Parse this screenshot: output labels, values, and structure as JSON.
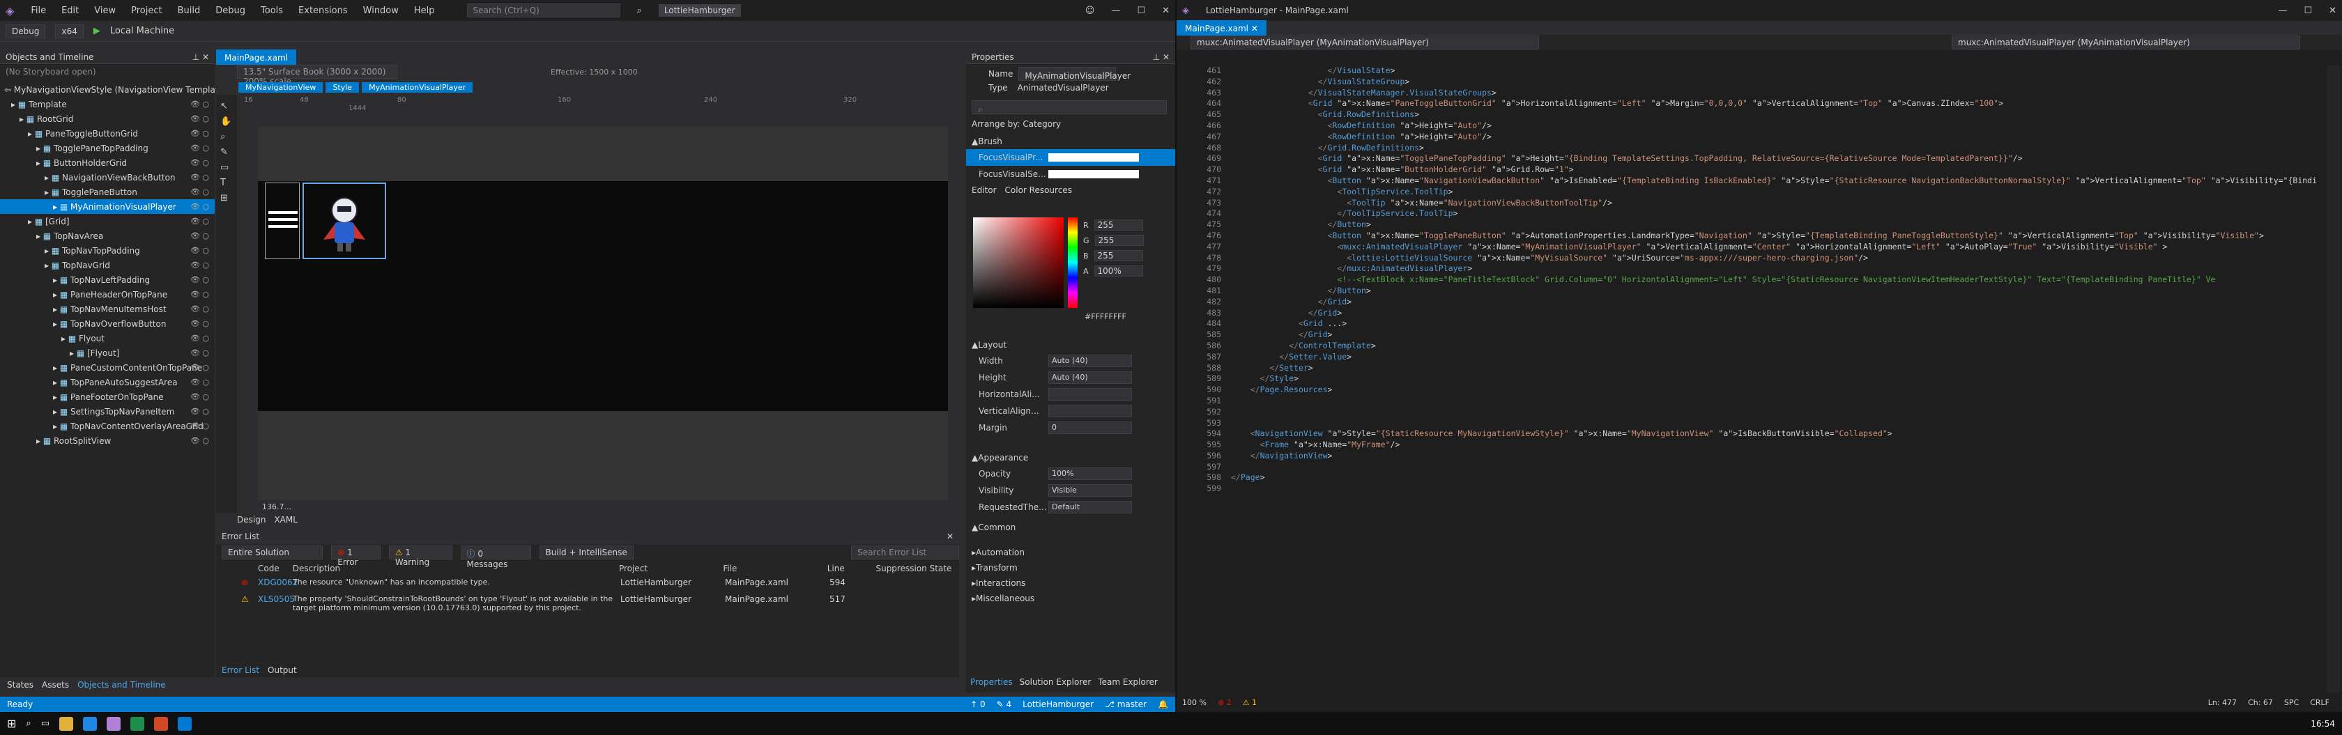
{
  "vs": {
    "menu": [
      "File",
      "Edit",
      "View",
      "Project",
      "Build",
      "Debug",
      "Tools",
      "Extensions",
      "Window",
      "Help"
    ],
    "search_placeholder": "Search (Ctrl+Q)",
    "solution": "LottieHamburger",
    "config": "Debug",
    "platform": "x64",
    "run": "Local Machine",
    "objects_title": "Objects and Timeline",
    "storyboard": "(No Storyboard open)",
    "root_node": "MyNavigationViewStyle (NavigationView Template)",
    "tree": [
      {
        "label": "Template",
        "indent": 1
      },
      {
        "label": "RootGrid",
        "indent": 2
      },
      {
        "label": "PaneToggleButtonGrid",
        "indent": 3
      },
      {
        "label": "TogglePaneTopPadding",
        "indent": 4
      },
      {
        "label": "ButtonHolderGrid",
        "indent": 4
      },
      {
        "label": "NavigationViewBackButton",
        "indent": 5
      },
      {
        "label": "TogglePaneButton",
        "indent": 5
      },
      {
        "label": "MyAnimationVisualPlayer",
        "indent": 6,
        "selected": true
      },
      {
        "label": "[Grid]",
        "indent": 3
      },
      {
        "label": "TopNavArea",
        "indent": 4
      },
      {
        "label": "TopNavTopPadding",
        "indent": 5
      },
      {
        "label": "TopNavGrid",
        "indent": 5
      },
      {
        "label": "TopNavLeftPadding",
        "indent": 6
      },
      {
        "label": "PaneHeaderOnTopPane",
        "indent": 6
      },
      {
        "label": "TopNavMenuItemsHost",
        "indent": 6
      },
      {
        "label": "TopNavOverflowButton",
        "indent": 6
      },
      {
        "label": "Flyout",
        "indent": 7
      },
      {
        "label": "[Flyout]",
        "indent": 8
      },
      {
        "label": "PaneCustomContentOnTopPane",
        "indent": 6
      },
      {
        "label": "TopPaneAutoSuggestArea",
        "indent": 6
      },
      {
        "label": "PaneFooterOnTopPane",
        "indent": 6
      },
      {
        "label": "SettingsTopNavPaneItem",
        "indent": 6
      },
      {
        "label": "TopNavContentOverlayAreaGrid",
        "indent": 6
      },
      {
        "label": "RootSplitView",
        "indent": 4
      }
    ],
    "bottom_tabs": [
      "States",
      "Assets",
      "Objects and Timeline"
    ],
    "designer": {
      "tab": "MainPage.xaml",
      "device": "13.5\" Surface Book (3000 x 2000) 200% scale",
      "effective": "Effective: 1500 x 1000",
      "breadcrumb": [
        "MyNavigationView",
        "Style",
        "MyAnimationVisualPlayer"
      ],
      "ruler": [
        "16",
        "48",
        "80",
        "160",
        "240",
        "320"
      ],
      "ruler_mark": "1444",
      "zoom": "136.7...",
      "view_tabs": [
        "Design",
        "XAML"
      ]
    },
    "errors": {
      "title": "Error List",
      "scope": "Entire Solution",
      "errors": "1 Error",
      "warnings": "1 Warning",
      "messages": "0 Messages",
      "build": "Build + IntelliSense",
      "search": "Search Error List",
      "cols": [
        "Code",
        "Description",
        "Project",
        "File",
        "Line",
        "Suppression State"
      ],
      "rows": [
        {
          "code": "XDG0062",
          "desc": "The resource \"Unknown\" has an incompatible type.",
          "project": "LottieHamburger",
          "file": "MainPage.xaml",
          "line": "594",
          "kind": "error"
        },
        {
          "code": "XLS0505",
          "desc": "The property 'ShouldConstrainToRootBounds' on type 'Flyout' is not available in the target platform minimum version (10.0.17763.0) supported by this project.",
          "project": "LottieHamburger",
          "file": "MainPage.xaml",
          "line": "517",
          "kind": "warning"
        }
      ],
      "tabs": [
        "Error List",
        "Output"
      ]
    },
    "props": {
      "title": "Properties",
      "name_label": "Name",
      "name": "MyAnimationVisualPlayer",
      "type_label": "Type",
      "type": "AnimatedVisualPlayer",
      "arrange": "Arrange by: Category",
      "brush": "Brush",
      "brush_items": [
        "FocusVisualPr...",
        "FocusVisualSe..."
      ],
      "editor": "Editor",
      "color_res": "Color Resources",
      "rgba": [
        {
          "k": "R",
          "v": "255"
        },
        {
          "k": "G",
          "v": "255"
        },
        {
          "k": "B",
          "v": "255"
        },
        {
          "k": "A",
          "v": "100%"
        }
      ],
      "hex": "#FFFFFFFF",
      "layout": "Layout",
      "rows": [
        {
          "k": "Width",
          "v": "Auto (40)"
        },
        {
          "k": "Height",
          "v": "Auto (40)"
        },
        {
          "k": "HorizontalAli...",
          "v": ""
        },
        {
          "k": "VerticalAlign...",
          "v": ""
        },
        {
          "k": "Margin",
          "v": "0"
        }
      ],
      "appearance": "Appearance",
      "app_rows": [
        {
          "k": "Opacity",
          "v": "100%"
        },
        {
          "k": "Visibility",
          "v": "Visible"
        },
        {
          "k": "RequestedThe...",
          "v": "Default"
        }
      ],
      "common": "Common",
      "sections": [
        "Automation",
        "Transform",
        "Interactions",
        "Miscellaneous"
      ],
      "tabs": [
        "Properties",
        "Solution Explorer",
        "Team Explorer"
      ]
    },
    "status": {
      "ready": "Ready",
      "up": "0",
      "pencil": "4",
      "project": "LottieHamburger",
      "branch": "master",
      "bell": "",
      "time": "16:54"
    }
  },
  "editor": {
    "title": "LottieHamburger - MainPage.xaml",
    "tab": "MainPage.xaml",
    "nav_left": "muxc:AnimatedVisualPlayer (MyAnimationVisualPlayer)",
    "nav_right": "muxc:AnimatedVisualPlayer (MyAnimationVisualPlayer)",
    "lines": [
      {
        "n": "461",
        "t": "                    </VisualState>"
      },
      {
        "n": "462",
        "t": "                  </VisualStateGroup>"
      },
      {
        "n": "463",
        "t": "                </VisualStateManager.VisualStateGroups>"
      },
      {
        "n": "464",
        "t": "                <Grid x:Name=\"PaneToggleButtonGrid\" HorizontalAlignment=\"Left\" Margin=\"0,0,0,0\" VerticalAlignment=\"Top\" Canvas.ZIndex=\"100\">"
      },
      {
        "n": "465",
        "t": "                  <Grid.RowDefinitions>"
      },
      {
        "n": "466",
        "t": "                    <RowDefinition Height=\"Auto\"/>"
      },
      {
        "n": "467",
        "t": "                    <RowDefinition Height=\"Auto\"/>"
      },
      {
        "n": "468",
        "t": "                  </Grid.RowDefinitions>"
      },
      {
        "n": "469",
        "t": "                  <Grid x:Name=\"TogglePaneTopPadding\" Height=\"{Binding TemplateSettings.TopPadding, RelativeSource={RelativeSource Mode=TemplatedParent}}\"/>"
      },
      {
        "n": "470",
        "t": "                  <Grid x:Name=\"ButtonHolderGrid\" Grid.Row=\"1\">"
      },
      {
        "n": "471",
        "t": "                    <Button x:Name=\"NavigationViewBackButton\" IsEnabled=\"{TemplateBinding IsBackEnabled}\" Style=\"{StaticResource NavigationBackButtonNormalStyle}\" VerticalAlignment=\"Top\" Visibility=\"{Bindi"
      },
      {
        "n": "472",
        "t": "                      <ToolTipService.ToolTip>"
      },
      {
        "n": "473",
        "t": "                        <ToolTip x:Name=\"NavigationViewBackButtonToolTip\"/>"
      },
      {
        "n": "474",
        "t": "                      </ToolTipService.ToolTip>"
      },
      {
        "n": "475",
        "t": "                    </Button>"
      },
      {
        "n": "476",
        "t": "                    <Button x:Name=\"TogglePaneButton\" AutomationProperties.LandmarkType=\"Navigation\" Style=\"{TemplateBinding PaneToggleButtonStyle}\" VerticalAlignment=\"Top\" Visibility=\"Visible\">"
      },
      {
        "n": "477",
        "t": "                      <muxc:AnimatedVisualPlayer x:Name=\"MyAnimationVisualPlayer\" VerticalAlignment=\"Center\" HorizontalAlignment=\"Left\" AutoPlay=\"True\" Visibility=\"Visible\" >"
      },
      {
        "n": "478",
        "t": "                        <lottie:LottieVisualSource x:Name=\"MyVisualSource\" UriSource=\"ms-appx:///super-hero-charging.json\"/>"
      },
      {
        "n": "479",
        "t": "                      </muxc:AnimatedVisualPlayer>"
      },
      {
        "n": "480",
        "t": "                      <!--<TextBlock x:Name=\"PaneTitleTextBlock\" Grid.Column=\"0\" HorizontalAlignment=\"Left\" Style=\"{StaticResource NavigationViewItemHeaderTextStyle}\" Text=\"{TemplateBinding PaneTitle}\" Ve"
      },
      {
        "n": "481",
        "t": "                    </Button>"
      },
      {
        "n": "482",
        "t": "                  </Grid>"
      },
      {
        "n": "483",
        "t": "                </Grid>"
      },
      {
        "n": "484",
        "t": "              <Grid ...>"
      },
      {
        "n": "585",
        "t": "              </Grid>"
      },
      {
        "n": "586",
        "t": "            </ControlTemplate>"
      },
      {
        "n": "587",
        "t": "          </Setter.Value>"
      },
      {
        "n": "588",
        "t": "        </Setter>"
      },
      {
        "n": "589",
        "t": "      </Style>"
      },
      {
        "n": "590",
        "t": "    </Page.Resources>"
      },
      {
        "n": "591",
        "t": ""
      },
      {
        "n": "592",
        "t": ""
      },
      {
        "n": "593",
        "t": ""
      },
      {
        "n": "594",
        "t": "    <NavigationView Style=\"{StaticResource MyNavigationViewStyle}\" x:Name=\"MyNavigationView\" IsBackButtonVisible=\"Collapsed\">"
      },
      {
        "n": "595",
        "t": "      <Frame x:Name=\"MyFrame\"/>"
      },
      {
        "n": "596",
        "t": "    </NavigationView>"
      },
      {
        "n": "597",
        "t": ""
      },
      {
        "n": "598",
        "t": "</Page>"
      },
      {
        "n": "599",
        "t": ""
      }
    ],
    "status": {
      "zoom": "100 %",
      "errors": "2",
      "warnings": "1",
      "pos": "Ln: 477",
      "col": "Ch: 67",
      "spc": "SPC",
      "crlf": "CRLF"
    }
  },
  "taskbar": {
    "time": "16:54"
  }
}
